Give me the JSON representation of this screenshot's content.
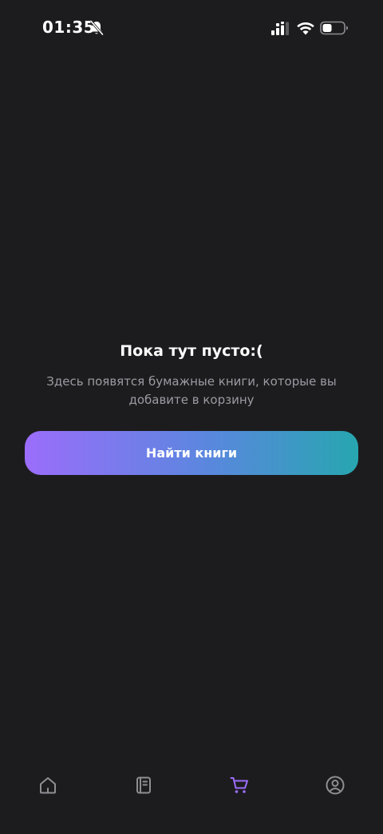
{
  "status_bar": {
    "time": "01:35",
    "icons": [
      "bell-off-icon",
      "signal-icon",
      "wifi-icon",
      "battery-icon"
    ]
  },
  "empty_state": {
    "title": "Пока тут пусто:(",
    "description": "Здесь появятся бумажные книги, которые вы добавите в корзину",
    "button_label": "Найти книги"
  },
  "bottom_nav": {
    "items": [
      {
        "icon": "home-icon",
        "active": false
      },
      {
        "icon": "book-icon",
        "active": false
      },
      {
        "icon": "cart-icon",
        "active": true
      },
      {
        "icon": "profile-icon",
        "active": false
      }
    ]
  },
  "colors": {
    "background": "#1c1c1e",
    "text_primary": "#ffffff",
    "text_secondary": "#9b9ba3",
    "nav_inactive": "#8e8e93",
    "nav_active": "#9b6dfb",
    "button_gradient_start": "#9b6dfb",
    "button_gradient_mid": "#5a87de",
    "button_gradient_end": "#27a6b0"
  }
}
